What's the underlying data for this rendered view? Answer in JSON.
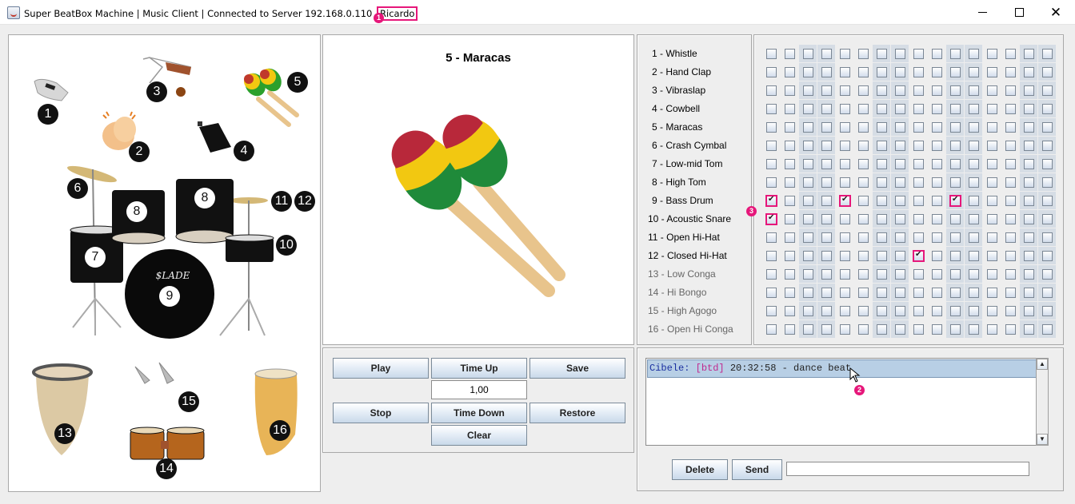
{
  "window": {
    "title": "Super BeatBox Machine | Music Client | Connected to Server 192.168.0.110",
    "user": "Ricardo",
    "annotations": [
      "1",
      "2",
      "3"
    ],
    "controls": {
      "minimize": "minimize",
      "maximize": "maximize",
      "close": "close"
    }
  },
  "instrument_map": {
    "badges": [
      "1",
      "2",
      "3",
      "4",
      "5",
      "6",
      "7",
      "8",
      "8",
      "9",
      "10",
      "11",
      "12",
      "13",
      "14",
      "15",
      "16"
    ],
    "images": [
      "whistle",
      "hand-clap",
      "vibraslap",
      "cowbell",
      "maracas",
      "drum-kit",
      "low-conga",
      "hi-bongo",
      "high-agogo",
      "open-hi-conga"
    ],
    "kit_logo": "$LADE"
  },
  "preview": {
    "title": "5 - Maracas",
    "image": "maracas"
  },
  "controls": {
    "play": "Play",
    "stop": "Stop",
    "time_up": "Time Up",
    "time_down": "Time Down",
    "tempo_value": "1,00",
    "save": "Save",
    "restore": "Restore",
    "clear": "Clear"
  },
  "instruments": [
    {
      "label": "1 - Whistle"
    },
    {
      "label": "2 - Hand Clap"
    },
    {
      "label": "3 - Vibraslap"
    },
    {
      "label": "4 - Cowbell"
    },
    {
      "label": "5 - Maracas"
    },
    {
      "label": "6 - Crash Cymbal"
    },
    {
      "label": "7 - Low-mid Tom"
    },
    {
      "label": "8 - High Tom"
    },
    {
      "label": "9 - Bass Drum"
    },
    {
      "label": "10 - Acoustic Snare"
    },
    {
      "label": "11 - Open Hi-Hat"
    },
    {
      "label": "12 - Closed Hi-Hat"
    },
    {
      "label": "13 - Low Conga"
    },
    {
      "label": "14 - Hi Bongo"
    },
    {
      "label": "15 - High Agogo"
    },
    {
      "label": "16 - Open Hi Conga"
    }
  ],
  "beat_grid": {
    "rows": 16,
    "columns": 16,
    "shaded_columns": [
      3,
      4,
      7,
      8,
      11,
      12,
      15,
      16
    ],
    "checked": [
      {
        "row": 9,
        "col": 1
      },
      {
        "row": 9,
        "col": 5
      },
      {
        "row": 9,
        "col": 11
      },
      {
        "row": 10,
        "col": 1
      },
      {
        "row": 12,
        "col": 9
      }
    ]
  },
  "chat": {
    "messages": [
      {
        "user": "Cibele:",
        "tag": "[btd]",
        "text": "20:32:58 - dance beat",
        "selected": true
      }
    ],
    "delete_label": "Delete",
    "send_label": "Send",
    "input_value": ""
  },
  "colors": {
    "highlight": "#e6177a",
    "selection": "#b8cfe5",
    "chat_user": "#1a2fa0",
    "chat_tag": "#c02a8f"
  }
}
